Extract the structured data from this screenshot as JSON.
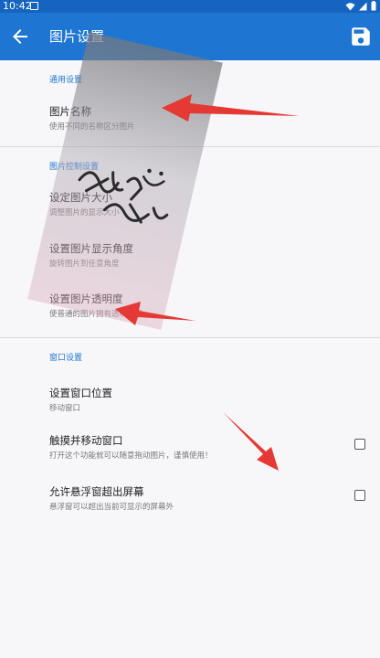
{
  "status_bar": {
    "time": "10:42"
  },
  "app_bar": {
    "title": "图片设置"
  },
  "sections": {
    "general": {
      "header": "通用设置",
      "items": [
        {
          "title": "图片名称",
          "subtitle": "使用不同的名称区分图片"
        }
      ]
    },
    "image_control": {
      "header": "图片控制设置",
      "items": [
        {
          "title": "设定图片大小",
          "subtitle": "调整图片的显示大小"
        },
        {
          "title": "设置图片显示角度",
          "subtitle": "旋转图片到任意角度"
        },
        {
          "title": "设置图片透明度",
          "subtitle": "使普通的图片拥有透明效果"
        }
      ]
    },
    "window": {
      "header": "窗口设置",
      "items": [
        {
          "title": "设置窗口位置",
          "subtitle": "移动窗口"
        },
        {
          "title": "触摸并移动窗口",
          "subtitle": "打开这个功能就可以随意拖动图片，谨慎使用！",
          "checked": false
        },
        {
          "title": "允许悬浮窗超出屏幕",
          "subtitle": "悬浮窗可以超出当前可显示的屏幕外",
          "checked": false
        }
      ]
    }
  },
  "colors": {
    "status_bar": "#1565c0",
    "app_bar": "#1e76d2",
    "accent": "#1e76d2",
    "annotation_arrow": "#e53935"
  },
  "icons": {
    "back": "arrow-left-icon",
    "save": "floppy-disk-icon"
  }
}
